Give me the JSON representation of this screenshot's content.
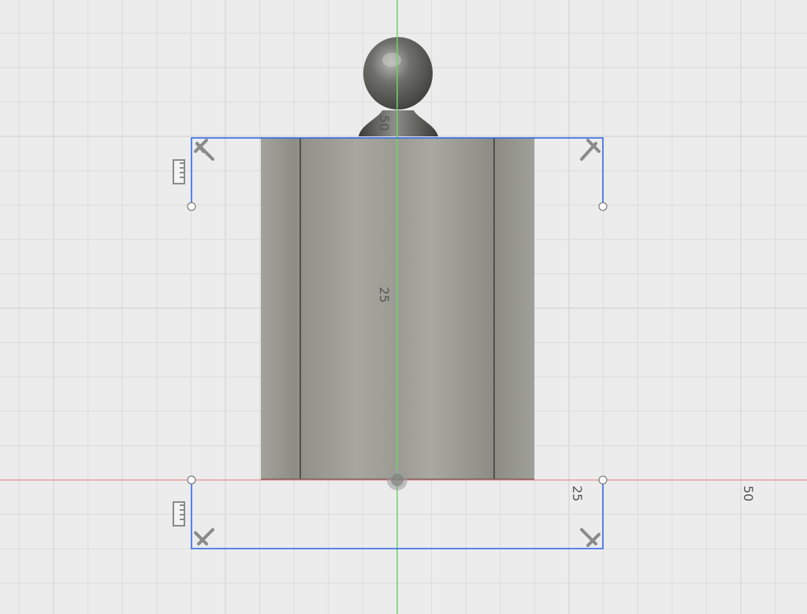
{
  "viewport": {
    "background": "#ececec",
    "grid_minor_color": "#dcdcdc",
    "grid_major_color": "#cfcfcf",
    "x_axis_color": "#e37b7b",
    "y_axis_color": "#6cd46c",
    "selection_color": "#2a63e6",
    "body_color": "#9a9a93"
  },
  "labels": {
    "x_tick_25": "25",
    "x_tick_50": "50",
    "y_tick_25": "25",
    "y_tick_50": "50"
  },
  "icons": {
    "gizmo_top_left": "t-arrow-icon",
    "gizmo_top_right": "t-arrow-icon",
    "gizmo_bottom_left": "t-arrow-icon",
    "gizmo_bottom_right": "t-arrow-icon",
    "ruler_top": "ruler-icon",
    "ruler_bottom": "ruler-icon",
    "origin": "origin-icon"
  }
}
